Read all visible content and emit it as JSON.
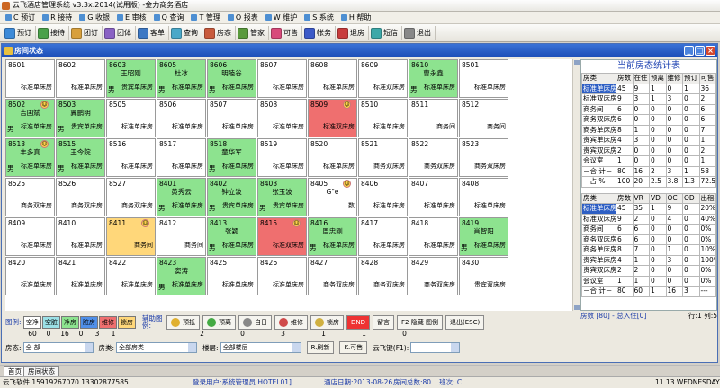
{
  "app_title": "云飞酒店管理系统  v3.3x.2014(试用版) -金力商务酒店",
  "menu": [
    "预订",
    "接待",
    "收银",
    "审核",
    "查询",
    "管理",
    "报表",
    "维护",
    "系统",
    "帮助"
  ],
  "menu_keys": [
    "C",
    "R",
    "G",
    "E",
    "Q",
    "T",
    "O",
    "W",
    "S",
    "H"
  ],
  "toolbar": [
    {
      "label": "预订",
      "color": "#3c8ad8"
    },
    {
      "label": "接待",
      "color": "#4aa14a"
    },
    {
      "label": "团订",
      "color": "#d8a03c"
    },
    {
      "label": "团体",
      "color": "#8a62c4"
    },
    {
      "label": "客单",
      "color": "#3c78c4"
    },
    {
      "label": "查询",
      "color": "#4aa8c8"
    },
    {
      "label": "房态",
      "color": "#c85a3c"
    },
    {
      "label": "管家",
      "color": "#5a9a3c"
    },
    {
      "label": "可售",
      "color": "#d84a7a"
    },
    {
      "label": "帐务",
      "color": "#3c5ac8"
    },
    {
      "label": "退房",
      "color": "#c83c3c"
    },
    {
      "label": "短信",
      "color": "#3ca8a8"
    },
    {
      "label": "退出",
      "color": "#888888"
    }
  ],
  "window_title": "房间状态",
  "rooms": [
    [
      {
        "no": "8601",
        "guest": "",
        "type": "标准单床房",
        "sex": "",
        "color": "w",
        "icon": false
      },
      {
        "no": "8602",
        "guest": "",
        "type": "标准单床房",
        "sex": "",
        "color": "w",
        "icon": false
      },
      {
        "no": "8603",
        "guest": "王昭刚",
        "type": "贵宾单床房",
        "sex": "男",
        "color": "g",
        "icon": false
      },
      {
        "no": "8605",
        "guest": "杜冰",
        "type": "标准单床房",
        "sex": "男",
        "color": "g",
        "icon": false
      },
      {
        "no": "8606",
        "guest": "明睦谷",
        "type": "标准单床房",
        "sex": "男",
        "color": "g",
        "icon": false
      },
      {
        "no": "8607",
        "guest": "",
        "type": "标准单床房",
        "sex": "",
        "color": "w",
        "icon": false
      },
      {
        "no": "8608",
        "guest": "",
        "type": "标准单床房",
        "sex": "",
        "color": "w",
        "icon": false
      },
      {
        "no": "8609",
        "guest": "",
        "type": "标准双床房",
        "sex": "",
        "color": "w",
        "icon": false
      },
      {
        "no": "8610",
        "guest": "曹永鑫",
        "type": "标准单床房",
        "sex": "男",
        "color": "g",
        "icon": false
      },
      {
        "no": "8501",
        "guest": "",
        "type": "标准单床房",
        "sex": "",
        "color": "w",
        "icon": false
      }
    ],
    [
      {
        "no": "8502",
        "guest": "吉国斌",
        "type": "标准单床房",
        "sex": "男",
        "color": "g",
        "icon": true
      },
      {
        "no": "8503",
        "guest": "翼鹏明",
        "type": "贵宾单床房",
        "sex": "男",
        "color": "g",
        "icon": false
      },
      {
        "no": "8505",
        "guest": "",
        "type": "标准单床房",
        "sex": "",
        "color": "w",
        "icon": false
      },
      {
        "no": "8506",
        "guest": "",
        "type": "标准单床房",
        "sex": "",
        "color": "w",
        "icon": false
      },
      {
        "no": "8507",
        "guest": "",
        "type": "标准单床房",
        "sex": "",
        "color": "w",
        "icon": false
      },
      {
        "no": "8508",
        "guest": "",
        "type": "标准单床房",
        "sex": "",
        "color": "w",
        "icon": false
      },
      {
        "no": "8509",
        "guest": "",
        "type": "标准双床房",
        "sex": "",
        "color": "r",
        "icon": true
      },
      {
        "no": "8510",
        "guest": "",
        "type": "标准单床房",
        "sex": "",
        "color": "w",
        "icon": false
      },
      {
        "no": "8511",
        "guest": "",
        "type": "商务间",
        "sex": "",
        "color": "w",
        "icon": false
      },
      {
        "no": "8512",
        "guest": "",
        "type": "商务间",
        "sex": "",
        "color": "w",
        "icon": false
      }
    ],
    [
      {
        "no": "8513",
        "guest": "丰多真",
        "type": "标准单床房",
        "sex": "男",
        "color": "g",
        "icon": true
      },
      {
        "no": "8515",
        "guest": "王令院",
        "type": "标准单床房",
        "sex": "男",
        "color": "g",
        "icon": false
      },
      {
        "no": "8516",
        "guest": "",
        "type": "标准单床房",
        "sex": "",
        "color": "w",
        "icon": false
      },
      {
        "no": "8517",
        "guest": "",
        "type": "标准单床房",
        "sex": "",
        "color": "w",
        "icon": false
      },
      {
        "no": "8518",
        "guest": "童华军",
        "type": "标准单床房",
        "sex": "男",
        "color": "g",
        "icon": false
      },
      {
        "no": "8519",
        "guest": "",
        "type": "标准单床房",
        "sex": "",
        "color": "w",
        "icon": false
      },
      {
        "no": "8520",
        "guest": "",
        "type": "标准单床房",
        "sex": "",
        "color": "w",
        "icon": false
      },
      {
        "no": "8521",
        "guest": "",
        "type": "商务双床房",
        "sex": "",
        "color": "w",
        "icon": false
      },
      {
        "no": "8522",
        "guest": "",
        "type": "商务双床房",
        "sex": "",
        "color": "w",
        "icon": false
      },
      {
        "no": "8523",
        "guest": "",
        "type": "商务双床房",
        "sex": "",
        "color": "w",
        "icon": false
      }
    ],
    [
      {
        "no": "8525",
        "guest": "",
        "type": "商务双床房",
        "sex": "",
        "color": "w",
        "icon": false
      },
      {
        "no": "8526",
        "guest": "",
        "type": "商务双床房",
        "sex": "",
        "color": "w",
        "icon": false
      },
      {
        "no": "8527",
        "guest": "",
        "type": "商务双床房",
        "sex": "",
        "color": "w",
        "icon": false
      },
      {
        "no": "8401",
        "guest": "黄秀云",
        "type": "标准单床房",
        "sex": "男",
        "color": "g",
        "icon": false
      },
      {
        "no": "8402",
        "guest": "钟立波",
        "type": "贵宾单床房",
        "sex": "男",
        "color": "g",
        "icon": false
      },
      {
        "no": "8403",
        "guest": "张玉波",
        "type": "贵宾单床房",
        "sex": "男",
        "color": "g",
        "icon": false
      },
      {
        "no": "8405",
        "guest": "G\"e",
        "type": "数",
        "sex": "",
        "color": "w",
        "icon": true
      },
      {
        "no": "8406",
        "guest": "",
        "type": "标准单床房",
        "sex": "",
        "color": "w",
        "icon": false
      },
      {
        "no": "8407",
        "guest": "",
        "type": "标准单床房",
        "sex": "",
        "color": "w",
        "icon": false
      },
      {
        "no": "8408",
        "guest": "",
        "type": "标准单床房",
        "sex": "",
        "color": "w",
        "icon": false
      }
    ],
    [
      {
        "no": "8409",
        "guest": "",
        "type": "标准单床房",
        "sex": "",
        "color": "w",
        "icon": false
      },
      {
        "no": "8410",
        "guest": "",
        "type": "标准单床房",
        "sex": "",
        "color": "w",
        "icon": false
      },
      {
        "no": "8411",
        "guest": "",
        "type": "商务间",
        "sex": "",
        "color": "y",
        "icon": true
      },
      {
        "no": "8412",
        "guest": "",
        "type": "商务间",
        "sex": "",
        "color": "w",
        "icon": false
      },
      {
        "no": "8413",
        "guest": "张颖",
        "type": "标准单床房",
        "sex": "男",
        "color": "g",
        "icon": false
      },
      {
        "no": "8415",
        "guest": "",
        "type": "标准双床房",
        "sex": "",
        "color": "r",
        "icon": true
      },
      {
        "no": "8416",
        "guest": "周忠刚",
        "type": "标准单床房",
        "sex": "男",
        "color": "g",
        "icon": false
      },
      {
        "no": "8417",
        "guest": "",
        "type": "标准单床房",
        "sex": "",
        "color": "w",
        "icon": false
      },
      {
        "no": "8418",
        "guest": "",
        "type": "标准单床房",
        "sex": "",
        "color": "w",
        "icon": false
      },
      {
        "no": "8419",
        "guest": "肖智阳",
        "type": "标准单床房",
        "sex": "男",
        "color": "g",
        "icon": false
      }
    ],
    [
      {
        "no": "8420",
        "guest": "",
        "type": "标准单床房",
        "sex": "",
        "color": "w",
        "icon": false
      },
      {
        "no": "8421",
        "guest": "",
        "type": "标准单床房",
        "sex": "",
        "color": "w",
        "icon": false
      },
      {
        "no": "8422",
        "guest": "",
        "type": "标准单床房",
        "sex": "",
        "color": "w",
        "icon": false
      },
      {
        "no": "8423",
        "guest": "窦涛",
        "type": "标准单床房",
        "sex": "男",
        "color": "g",
        "icon": false
      },
      {
        "no": "8425",
        "guest": "",
        "type": "标准单床房",
        "sex": "",
        "color": "w",
        "icon": false
      },
      {
        "no": "8426",
        "guest": "",
        "type": "标准单床房",
        "sex": "",
        "color": "w",
        "icon": false
      },
      {
        "no": "8427",
        "guest": "",
        "type": "商务双床房",
        "sex": "",
        "color": "w",
        "icon": false
      },
      {
        "no": "8428",
        "guest": "",
        "type": "商务双床房",
        "sex": "",
        "color": "w",
        "icon": false
      },
      {
        "no": "8429",
        "guest": "",
        "type": "商务双床房",
        "sex": "",
        "color": "w",
        "icon": false
      },
      {
        "no": "8430",
        "guest": "",
        "type": "贵宾双床房",
        "sex": "",
        "color": "w",
        "icon": false
      }
    ]
  ],
  "stats_title": "当前房态统计表",
  "stats1": {
    "headers": [
      "房类",
      "房数",
      "在住",
      "预离",
      "维修",
      "预订",
      "可售"
    ],
    "rows": [
      [
        "标准单床房",
        "45",
        "9",
        "1",
        "0",
        "1",
        "36"
      ],
      [
        "标准双床房",
        "9",
        "3",
        "1",
        "3",
        "0",
        "2"
      ],
      [
        "商务间",
        "6",
        "0",
        "0",
        "0",
        "0",
        "6"
      ],
      [
        "商务双床房",
        "6",
        "0",
        "0",
        "0",
        "0",
        "6"
      ],
      [
        "商务单床房",
        "8",
        "1",
        "0",
        "0",
        "0",
        "7"
      ],
      [
        "贵宾单床房",
        "4",
        "3",
        "0",
        "0",
        "0",
        "1"
      ],
      [
        "贵宾双床房",
        "2",
        "0",
        "0",
        "0",
        "0",
        "2"
      ],
      [
        "会议室",
        "1",
        "0",
        "0",
        "0",
        "0",
        "1"
      ],
      [
        "－合 计－",
        "80",
        "16",
        "2",
        "3",
        "1",
        "58"
      ],
      [
        "－占 %－",
        "100",
        "20",
        "2.5",
        "3.8",
        "1.3",
        "72.5"
      ]
    ]
  },
  "stats2": {
    "headers": [
      "房类",
      "房数",
      "VR",
      "VD",
      "OC",
      "OD",
      "出租率"
    ],
    "rows": [
      [
        "标准单床房",
        "45",
        "35",
        "1",
        "9",
        "0",
        "20%"
      ],
      [
        "标准双床房",
        "9",
        "2",
        "0",
        "4",
        "0",
        "40%"
      ],
      [
        "商务间",
        "6",
        "6",
        "0",
        "0",
        "0",
        "0%"
      ],
      [
        "商务双床房",
        "6",
        "6",
        "0",
        "0",
        "0",
        "0%"
      ],
      [
        "商务单床房",
        "8",
        "7",
        "0",
        "1",
        "0",
        "10%"
      ],
      [
        "贵宾单床房",
        "4",
        "1",
        "0",
        "3",
        "0",
        "100%"
      ],
      [
        "贵宾双床房",
        "2",
        "2",
        "0",
        "0",
        "0",
        "0%"
      ],
      [
        "会议室",
        "1",
        "1",
        "0",
        "0",
        "0",
        "0%"
      ],
      [
        "－合 计－",
        "80",
        "60",
        "1",
        "16",
        "3",
        "---"
      ]
    ]
  },
  "stats_footer": {
    "count": "房数 [80] - 总入住[0]",
    "rowcol": "行:1 列:5"
  },
  "legend": {
    "label": "图例:",
    "swatches": [
      {
        "label": "空净",
        "color": "#ffffff"
      },
      {
        "label": "空脏",
        "color": "#9be0e6"
      },
      {
        "label": "净房",
        "color": "#8de38f"
      },
      {
        "label": "脏房",
        "color": "#4f8fe8"
      },
      {
        "label": "维修",
        "color": "#ef6f6f"
      },
      {
        "label": "锁房",
        "color": "#ffd77a"
      }
    ],
    "aux_label": "辅助图例:",
    "aux": [
      {
        "label": "预抵",
        "color": "#e0b030"
      },
      {
        "label": "预离",
        "color": "#44aa44"
      },
      {
        "label": "自日",
        "color": "#888888"
      },
      {
        "label": "维修",
        "color": "#d04a4a"
      },
      {
        "label": "锁房",
        "color": "#d0b040"
      }
    ],
    "btns": [
      "DND",
      "留言",
      "F2 隐藏\n图例",
      "退出(ESC)"
    ],
    "counts": [
      "60",
      "0",
      "16",
      "0",
      "3",
      "1"
    ],
    "counts2": [
      "2",
      "0",
      "3",
      "1",
      "1",
      "0"
    ]
  },
  "filters": {
    "floor_label": "房态:",
    "floor_val": "全    部",
    "type_label": "房类:",
    "type_val": "全部房类",
    "bld_label": "楼层:",
    "bld_val": "全部楼层",
    "refresh": "R.刷新",
    "sell": "K.可售",
    "key_label": "云飞键(F1):"
  },
  "tabs": [
    "首页",
    "房间状态"
  ],
  "status": {
    "company": "云飞软件 15919267070 13302877585",
    "user": "登录用户:系统管理员  HOTEL01]",
    "date": "酒店日期:2013-08-26",
    "rooms": "房间总数:80",
    "shift": "班次: C",
    "time": "11.13  WEDNESDAY"
  }
}
